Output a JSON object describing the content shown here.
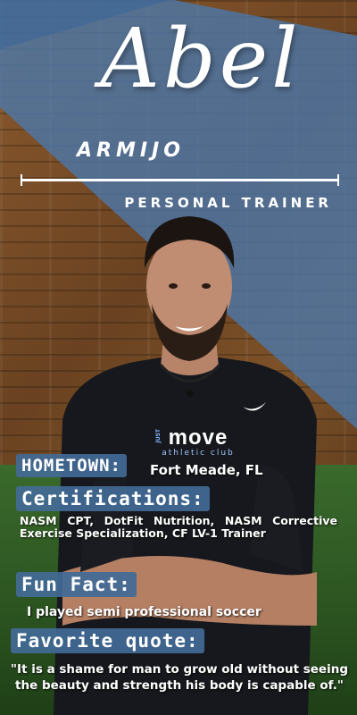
{
  "name": {
    "first": "Abel",
    "last": "ARMIJO"
  },
  "role": "PERSONAL TRAINER",
  "shirt_logo": {
    "line1": "JUST",
    "line2": "move",
    "line3": "athletic club"
  },
  "hometown": {
    "label": "HOMETOWN:",
    "value": "Fort Meade, FL"
  },
  "certifications": {
    "label": "Certifications:",
    "value": "NASM CPT, DotFit Nutrition, NASM Corrective Exercise Specialization, CF LV-1 Trainer"
  },
  "fun_fact": {
    "label": "Fun Fact:",
    "value": "I played semi professional soccer"
  },
  "favorite_quote": {
    "label": "Favorite quote:",
    "value": "\"It is a shame for man to grow old without seeing the beauty and strength his body is capable of.\""
  },
  "colors": {
    "accent_blue": "#426a96",
    "text": "#ffffff"
  }
}
